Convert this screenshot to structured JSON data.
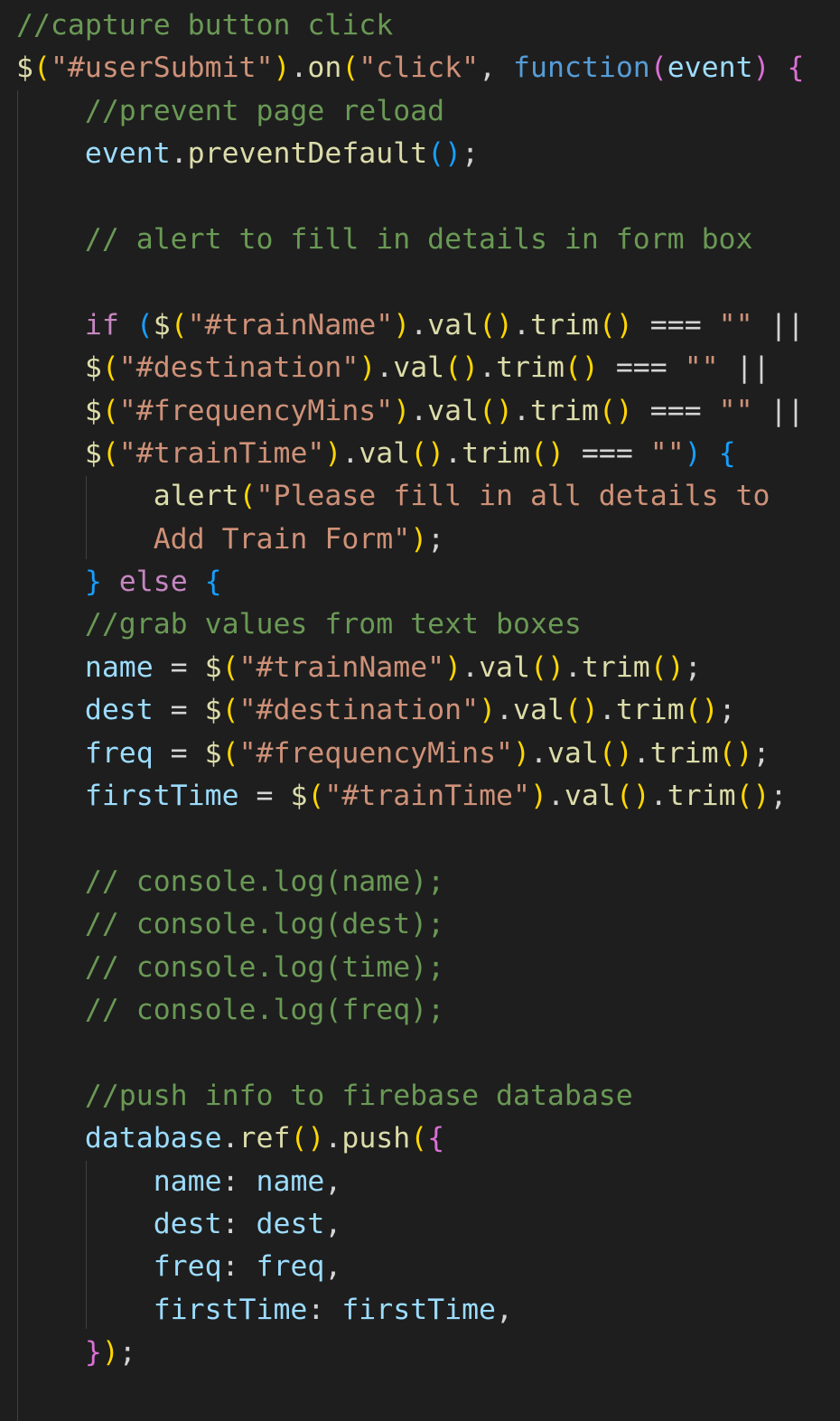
{
  "editor": {
    "theme": "dark",
    "background": "#1e1e1e",
    "language": "javascript"
  },
  "colors": {
    "comment": "#6a9955",
    "string": "#ce9178",
    "variable": "#9cdcfe",
    "function": "#dcdcaa",
    "keyword_blue": "#569cd6",
    "keyword_purple": "#c586c0",
    "bracket_gold": "#ffd700",
    "bracket_magenta": "#da70d6",
    "bracket_blue": "#179fff"
  },
  "lines": [
    [
      {
        "t": "//capture button click",
        "c": "c"
      }
    ],
    [
      {
        "t": "$",
        "c": "f"
      },
      {
        "t": "(",
        "c": "b1"
      },
      {
        "t": "\"#userSubmit\"",
        "c": "s"
      },
      {
        "t": ")",
        "c": "b1"
      },
      {
        "t": ".",
        "c": "op"
      },
      {
        "t": "on",
        "c": "f"
      },
      {
        "t": "(",
        "c": "b1"
      },
      {
        "t": "\"click\"",
        "c": "s"
      },
      {
        "t": ", ",
        "c": "op"
      },
      {
        "t": "function",
        "c": "k"
      },
      {
        "t": "(",
        "c": "b2"
      },
      {
        "t": "event",
        "c": "v"
      },
      {
        "t": ")",
        "c": "b2"
      },
      {
        "t": " ",
        "c": "op"
      },
      {
        "t": "{",
        "c": "b2"
      }
    ],
    [
      {
        "t": "    //prevent page reload",
        "c": "c"
      }
    ],
    [
      {
        "t": "    ",
        "c": "op"
      },
      {
        "t": "event",
        "c": "v"
      },
      {
        "t": ".",
        "c": "op"
      },
      {
        "t": "preventDefault",
        "c": "f"
      },
      {
        "t": "()",
        "c": "b3"
      },
      {
        "t": ";",
        "c": "op"
      }
    ],
    [
      {
        "t": "",
        "c": "op"
      }
    ],
    [
      {
        "t": "    // alert to fill in details in form box",
        "c": "c"
      }
    ],
    [
      {
        "t": "",
        "c": "op"
      }
    ],
    [
      {
        "t": "    ",
        "c": "op"
      },
      {
        "t": "if",
        "c": "kw"
      },
      {
        "t": " ",
        "c": "op"
      },
      {
        "t": "(",
        "c": "b3"
      },
      {
        "t": "$",
        "c": "f"
      },
      {
        "t": "(",
        "c": "b1"
      },
      {
        "t": "\"#trainName\"",
        "c": "s"
      },
      {
        "t": ")",
        "c": "b1"
      },
      {
        "t": ".",
        "c": "op"
      },
      {
        "t": "val",
        "c": "f"
      },
      {
        "t": "()",
        "c": "b1"
      },
      {
        "t": ".",
        "c": "op"
      },
      {
        "t": "trim",
        "c": "f"
      },
      {
        "t": "()",
        "c": "b1"
      },
      {
        "t": " === ",
        "c": "op"
      },
      {
        "t": "\"\"",
        "c": "s"
      },
      {
        "t": " ||",
        "c": "op"
      }
    ],
    [
      {
        "t": "    ",
        "c": "op"
      },
      {
        "t": "$",
        "c": "f"
      },
      {
        "t": "(",
        "c": "b1"
      },
      {
        "t": "\"#destination\"",
        "c": "s"
      },
      {
        "t": ")",
        "c": "b1"
      },
      {
        "t": ".",
        "c": "op"
      },
      {
        "t": "val",
        "c": "f"
      },
      {
        "t": "()",
        "c": "b1"
      },
      {
        "t": ".",
        "c": "op"
      },
      {
        "t": "trim",
        "c": "f"
      },
      {
        "t": "()",
        "c": "b1"
      },
      {
        "t": " === ",
        "c": "op"
      },
      {
        "t": "\"\"",
        "c": "s"
      },
      {
        "t": " ||",
        "c": "op"
      }
    ],
    [
      {
        "t": "    ",
        "c": "op"
      },
      {
        "t": "$",
        "c": "f"
      },
      {
        "t": "(",
        "c": "b1"
      },
      {
        "t": "\"#frequencyMins\"",
        "c": "s"
      },
      {
        "t": ")",
        "c": "b1"
      },
      {
        "t": ".",
        "c": "op"
      },
      {
        "t": "val",
        "c": "f"
      },
      {
        "t": "()",
        "c": "b1"
      },
      {
        "t": ".",
        "c": "op"
      },
      {
        "t": "trim",
        "c": "f"
      },
      {
        "t": "()",
        "c": "b1"
      },
      {
        "t": " === ",
        "c": "op"
      },
      {
        "t": "\"\"",
        "c": "s"
      },
      {
        "t": " ||",
        "c": "op"
      }
    ],
    [
      {
        "t": "    ",
        "c": "op"
      },
      {
        "t": "$",
        "c": "f"
      },
      {
        "t": "(",
        "c": "b1"
      },
      {
        "t": "\"#trainTime\"",
        "c": "s"
      },
      {
        "t": ")",
        "c": "b1"
      },
      {
        "t": ".",
        "c": "op"
      },
      {
        "t": "val",
        "c": "f"
      },
      {
        "t": "()",
        "c": "b1"
      },
      {
        "t": ".",
        "c": "op"
      },
      {
        "t": "trim",
        "c": "f"
      },
      {
        "t": "()",
        "c": "b1"
      },
      {
        "t": " === ",
        "c": "op"
      },
      {
        "t": "\"\"",
        "c": "s"
      },
      {
        "t": ")",
        "c": "b3"
      },
      {
        "t": " ",
        "c": "op"
      },
      {
        "t": "{",
        "c": "b3"
      }
    ],
    [
      {
        "t": "        ",
        "c": "op"
      },
      {
        "t": "alert",
        "c": "f"
      },
      {
        "t": "(",
        "c": "b1"
      },
      {
        "t": "\"Please fill in all details to",
        "c": "s"
      }
    ],
    [
      {
        "t": "        ",
        "c": "op"
      },
      {
        "t": "Add Train Form\"",
        "c": "s"
      },
      {
        "t": ")",
        "c": "b1"
      },
      {
        "t": ";",
        "c": "op"
      }
    ],
    [
      {
        "t": "    ",
        "c": "op"
      },
      {
        "t": "}",
        "c": "b3"
      },
      {
        "t": " ",
        "c": "op"
      },
      {
        "t": "else",
        "c": "kw"
      },
      {
        "t": " ",
        "c": "op"
      },
      {
        "t": "{",
        "c": "b3"
      }
    ],
    [
      {
        "t": "    //grab values from text boxes",
        "c": "c"
      }
    ],
    [
      {
        "t": "    ",
        "c": "op"
      },
      {
        "t": "name",
        "c": "v"
      },
      {
        "t": " = ",
        "c": "op"
      },
      {
        "t": "$",
        "c": "f"
      },
      {
        "t": "(",
        "c": "b1"
      },
      {
        "t": "\"#trainName\"",
        "c": "s"
      },
      {
        "t": ")",
        "c": "b1"
      },
      {
        "t": ".",
        "c": "op"
      },
      {
        "t": "val",
        "c": "f"
      },
      {
        "t": "()",
        "c": "b1"
      },
      {
        "t": ".",
        "c": "op"
      },
      {
        "t": "trim",
        "c": "f"
      },
      {
        "t": "()",
        "c": "b1"
      },
      {
        "t": ";",
        "c": "op"
      }
    ],
    [
      {
        "t": "    ",
        "c": "op"
      },
      {
        "t": "dest",
        "c": "v"
      },
      {
        "t": " = ",
        "c": "op"
      },
      {
        "t": "$",
        "c": "f"
      },
      {
        "t": "(",
        "c": "b1"
      },
      {
        "t": "\"#destination\"",
        "c": "s"
      },
      {
        "t": ")",
        "c": "b1"
      },
      {
        "t": ".",
        "c": "op"
      },
      {
        "t": "val",
        "c": "f"
      },
      {
        "t": "()",
        "c": "b1"
      },
      {
        "t": ".",
        "c": "op"
      },
      {
        "t": "trim",
        "c": "f"
      },
      {
        "t": "()",
        "c": "b1"
      },
      {
        "t": ";",
        "c": "op"
      }
    ],
    [
      {
        "t": "    ",
        "c": "op"
      },
      {
        "t": "freq",
        "c": "v"
      },
      {
        "t": " = ",
        "c": "op"
      },
      {
        "t": "$",
        "c": "f"
      },
      {
        "t": "(",
        "c": "b1"
      },
      {
        "t": "\"#frequencyMins\"",
        "c": "s"
      },
      {
        "t": ")",
        "c": "b1"
      },
      {
        "t": ".",
        "c": "op"
      },
      {
        "t": "val",
        "c": "f"
      },
      {
        "t": "()",
        "c": "b1"
      },
      {
        "t": ".",
        "c": "op"
      },
      {
        "t": "trim",
        "c": "f"
      },
      {
        "t": "()",
        "c": "b1"
      },
      {
        "t": ";",
        "c": "op"
      }
    ],
    [
      {
        "t": "    ",
        "c": "op"
      },
      {
        "t": "firstTime",
        "c": "v"
      },
      {
        "t": " = ",
        "c": "op"
      },
      {
        "t": "$",
        "c": "f"
      },
      {
        "t": "(",
        "c": "b1"
      },
      {
        "t": "\"#trainTime\"",
        "c": "s"
      },
      {
        "t": ")",
        "c": "b1"
      },
      {
        "t": ".",
        "c": "op"
      },
      {
        "t": "val",
        "c": "f"
      },
      {
        "t": "()",
        "c": "b1"
      },
      {
        "t": ".",
        "c": "op"
      },
      {
        "t": "trim",
        "c": "f"
      },
      {
        "t": "()",
        "c": "b1"
      },
      {
        "t": ";",
        "c": "op"
      }
    ],
    [
      {
        "t": "",
        "c": "op"
      }
    ],
    [
      {
        "t": "    // console.log(name);",
        "c": "c"
      }
    ],
    [
      {
        "t": "    // console.log(dest);",
        "c": "c"
      }
    ],
    [
      {
        "t": "    // console.log(time);",
        "c": "c"
      }
    ],
    [
      {
        "t": "    // console.log(freq);",
        "c": "c"
      }
    ],
    [
      {
        "t": "",
        "c": "op"
      }
    ],
    [
      {
        "t": "    //push info to firebase database",
        "c": "c"
      }
    ],
    [
      {
        "t": "    ",
        "c": "op"
      },
      {
        "t": "database",
        "c": "v"
      },
      {
        "t": ".",
        "c": "op"
      },
      {
        "t": "ref",
        "c": "f"
      },
      {
        "t": "()",
        "c": "b1"
      },
      {
        "t": ".",
        "c": "op"
      },
      {
        "t": "push",
        "c": "f"
      },
      {
        "t": "(",
        "c": "b1"
      },
      {
        "t": "{",
        "c": "b2"
      }
    ],
    [
      {
        "t": "        ",
        "c": "op"
      },
      {
        "t": "name",
        "c": "v"
      },
      {
        "t": ": ",
        "c": "op"
      },
      {
        "t": "name",
        "c": "v"
      },
      {
        "t": ",",
        "c": "op"
      }
    ],
    [
      {
        "t": "        ",
        "c": "op"
      },
      {
        "t": "dest",
        "c": "v"
      },
      {
        "t": ": ",
        "c": "op"
      },
      {
        "t": "dest",
        "c": "v"
      },
      {
        "t": ",",
        "c": "op"
      }
    ],
    [
      {
        "t": "        ",
        "c": "op"
      },
      {
        "t": "freq",
        "c": "v"
      },
      {
        "t": ": ",
        "c": "op"
      },
      {
        "t": "freq",
        "c": "v"
      },
      {
        "t": ",",
        "c": "op"
      }
    ],
    [
      {
        "t": "        ",
        "c": "op"
      },
      {
        "t": "firstTime",
        "c": "v"
      },
      {
        "t": ": ",
        "c": "op"
      },
      {
        "t": "firstTime",
        "c": "v"
      },
      {
        "t": ",",
        "c": "op"
      }
    ],
    [
      {
        "t": "    ",
        "c": "op"
      },
      {
        "t": "}",
        "c": "b2"
      },
      {
        "t": ")",
        "c": "b1"
      },
      {
        "t": ";",
        "c": "op"
      }
    ],
    [
      {
        "t": "",
        "c": "op"
      }
    ]
  ]
}
